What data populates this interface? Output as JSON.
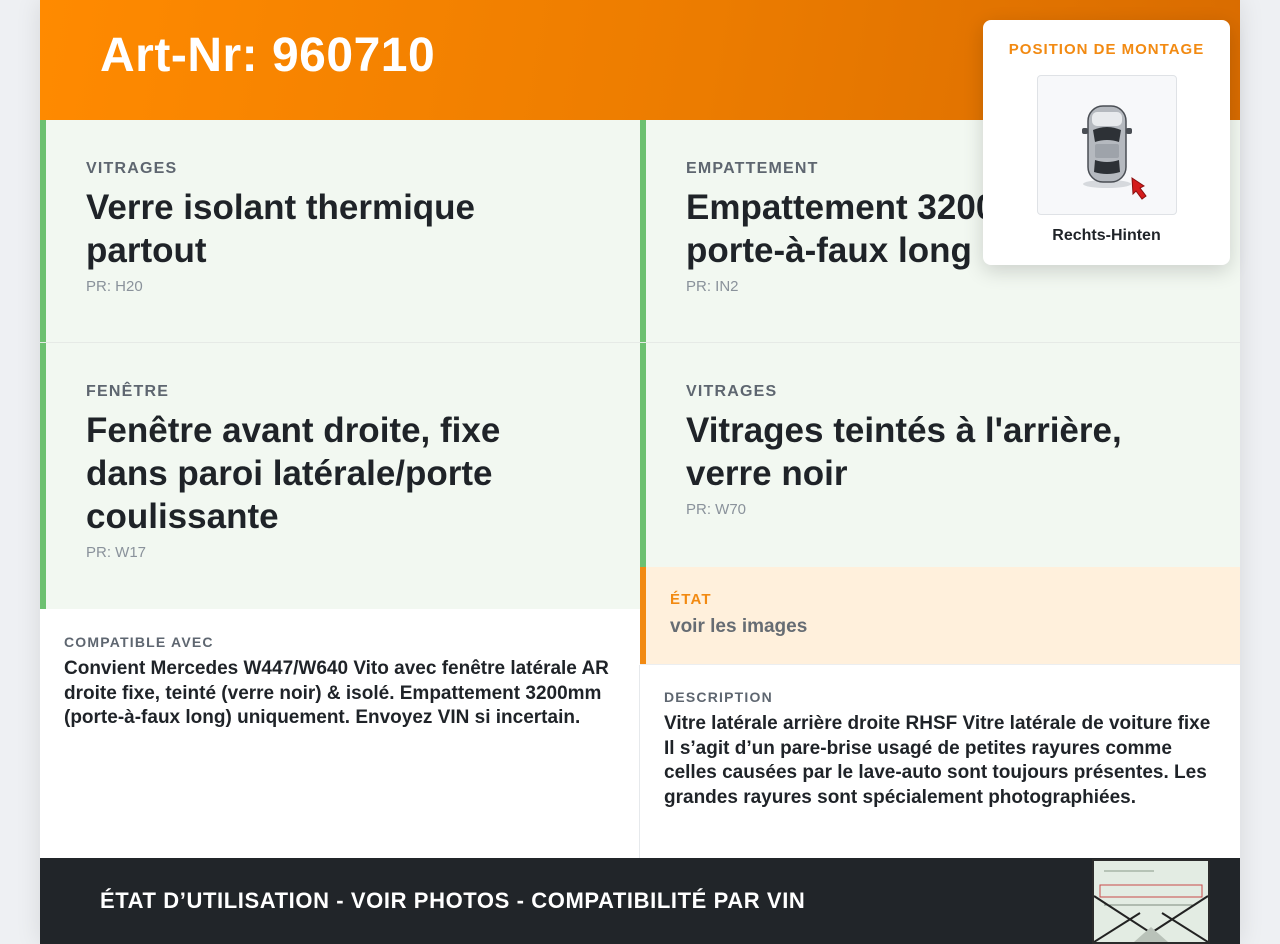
{
  "header": {
    "title": "Art-Nr: 960710"
  },
  "specs": [
    {
      "label": "VITRAGES",
      "value": "Verre isolant thermique partout",
      "code": "PR: H20"
    },
    {
      "label": "EMPATTEMENT",
      "value": "Empattement 3200mm, porte-à-faux long",
      "code": "PR: IN2"
    },
    {
      "label": "FENÊTRE",
      "value": "Fenêtre avant droite, fixe dans paroi latérale/porte coulissante",
      "code": "PR: W17"
    },
    {
      "label": "VITRAGES",
      "value": "Vitrages teintés à l'arrière, verre noir",
      "code": "PR: W70"
    }
  ],
  "state": {
    "label": "ÉTAT",
    "value": "voir les images"
  },
  "compatible": {
    "label": "COMPATIBLE AVEC",
    "text": "Convient Mercedes W447/W640 Vito avec fenêtre latérale AR droite fixe, teinté (verre noir) & isolé. Empattement 3200mm (porte-à-faux long) uniquement. Envoyez VIN si incertain."
  },
  "description": {
    "label": "DESCRIPTION",
    "text": "Vitre latérale arrière droite RHSF Vitre latérale de voiture fixe Il s’agit d’un pare-brise usagé de petites rayures comme celles causées par le lave-auto sont toujours présentes. Les grandes rayures sont spécialement photographiées."
  },
  "footer": {
    "text": "ÉTAT D’UTILISATION - VOIR PHOTOS - COMPATIBILITÉ PAR VIN"
  },
  "mount": {
    "label": "POSITION DE MONTAGE",
    "position": "Rechts-Hinten",
    "icon": "car-top-view-icon"
  },
  "colors": {
    "accent": "#f28a12",
    "header_start": "#ff8a00",
    "spec_bg": "#f2f8f1",
    "spec_border": "#6cc070",
    "state_bg": "#fff0dc",
    "footer_bg": "#212529"
  }
}
